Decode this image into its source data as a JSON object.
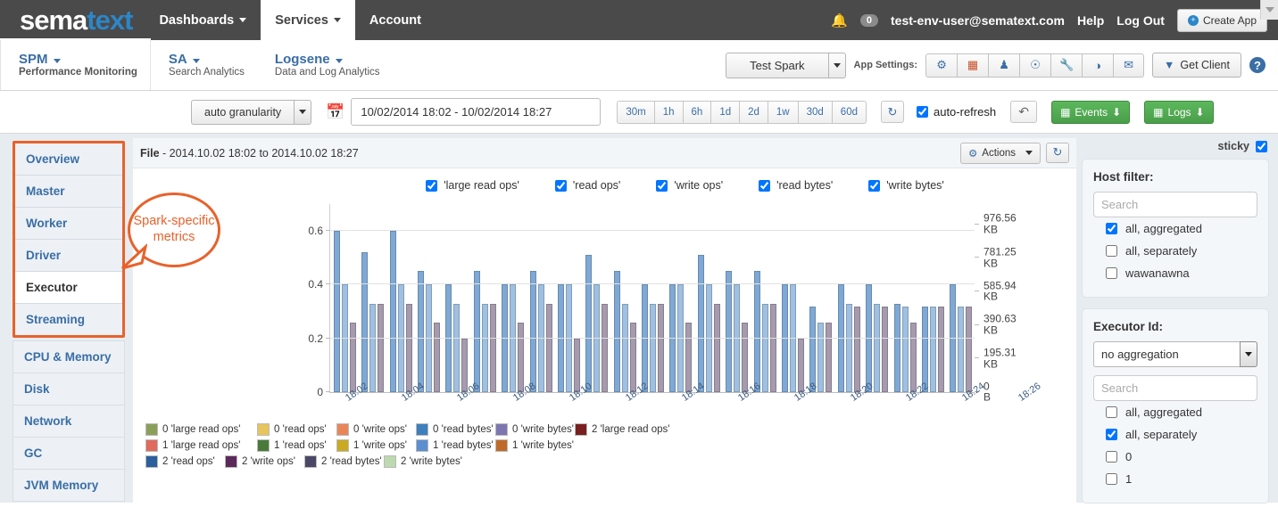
{
  "brand": {
    "part1": "sema",
    "part2": "text",
    "accent": "#2c86c8"
  },
  "topnav": {
    "items": [
      {
        "label": "Dashboards",
        "caret": true,
        "active": false
      },
      {
        "label": "Services",
        "caret": true,
        "active": true
      },
      {
        "label": "Account",
        "caret": false,
        "active": false
      }
    ],
    "bell_icon": "bell-icon",
    "notification_count": "0",
    "user_email": "test-env-user@sematext.com",
    "help": "Help",
    "logout": "Log Out",
    "create_app": "Create App"
  },
  "apptabs": [
    {
      "title": "SPM",
      "subtitle": "Performance Monitoring",
      "active": true
    },
    {
      "title": "SA",
      "subtitle": "Search Analytics",
      "active": false
    },
    {
      "title": "Logsene",
      "subtitle": "Data and Log Analytics",
      "active": false
    }
  ],
  "subbar": {
    "app_selected": "Test Spark",
    "app_settings_label": "App Settings:",
    "icons": [
      "gear-icon",
      "card-icon",
      "group-icon",
      "bell-icon",
      "wrench-icon",
      "speedometer-icon",
      "envelope-icon"
    ],
    "get_client": "Get Client",
    "help_icon": "help-icon"
  },
  "filterbar": {
    "granularity": "auto granularity",
    "calendar_icon": "calendar-icon",
    "date_range": "10/02/2014 18:02 - 10/02/2014 18:27",
    "ranges": [
      "30m",
      "1h",
      "6h",
      "1d",
      "2d",
      "1w",
      "30d",
      "60d"
    ],
    "refresh_icon": "refresh-icon",
    "auto_refresh_label": "auto-refresh",
    "auto_refresh_checked": true,
    "undo_icon": "undo-icon",
    "events_button": "Events",
    "logs_button": "Logs"
  },
  "sidebar": {
    "highlight_color": "#e8622c",
    "spark_group": [
      {
        "label": "Overview",
        "active": false
      },
      {
        "label": "Master",
        "active": false
      },
      {
        "label": "Worker",
        "active": false
      },
      {
        "label": "Driver",
        "active": false
      },
      {
        "label": "Executor",
        "active": true
      },
      {
        "label": "Streaming",
        "active": false
      }
    ],
    "other_group": [
      {
        "label": "CPU & Memory"
      },
      {
        "label": "Disk"
      },
      {
        "label": "Network"
      },
      {
        "label": "GC"
      },
      {
        "label": "JVM Memory"
      }
    ]
  },
  "callout": {
    "text": "Spark-specific metrics",
    "color": "#e8622c"
  },
  "chart_panel": {
    "title_bold": "File",
    "title_rest": " - 2014.10.02 18:02 to 2014.10.02 18:27",
    "actions_label": "Actions",
    "actions_icon": "gears-icon",
    "refresh_icon": "refresh-icon",
    "series_toggles": [
      {
        "label": "'large read ops'",
        "checked": true
      },
      {
        "label": "'read ops'",
        "checked": true
      },
      {
        "label": "'write ops'",
        "checked": true
      },
      {
        "label": "'read bytes'",
        "checked": true
      },
      {
        "label": "'write bytes'",
        "checked": true
      }
    ]
  },
  "right_panel": {
    "sticky_label": "sticky",
    "sticky_checked": true,
    "host_filter": {
      "title": "Host filter:",
      "search_placeholder": "Search",
      "search_value": "",
      "options": [
        {
          "label": "all, aggregated",
          "checked": true
        },
        {
          "label": "all, separately",
          "checked": false
        },
        {
          "label": "wawanawna",
          "checked": false
        }
      ]
    },
    "executor_id": {
      "title": "Executor Id:",
      "aggregation": "no aggregation",
      "search_placeholder": "Search",
      "search_value": "",
      "options": [
        {
          "label": "all, aggregated",
          "checked": false
        },
        {
          "label": "all, separately",
          "checked": true
        },
        {
          "label": "0",
          "checked": false
        },
        {
          "label": "1",
          "checked": false
        }
      ]
    }
  },
  "chart_data": {
    "type": "bar",
    "title": "File - 2014.10.02 18:02 to 2014.10.02 18:27",
    "xlabel": "",
    "ylabel": "",
    "grid": true,
    "legend_position": "bottom",
    "left_axis": {
      "ticks": [
        "0",
        "0.2",
        "0.4",
        "0.6"
      ],
      "values": [
        0,
        0.2,
        0.4,
        0.6
      ],
      "ylim": [
        0,
        0.7
      ]
    },
    "right_axis": {
      "ticks": [
        "0 B",
        "195.31 KB",
        "390.63 KB",
        "585.94 KB",
        "781.25 KB",
        "976.56 KB"
      ],
      "values": [
        0,
        195.31,
        390.63,
        585.94,
        781.25,
        976.56
      ],
      "unit": "KB",
      "ylim": [
        0,
        1093.75
      ]
    },
    "x_tick_labels": [
      "18:02",
      "18:04",
      "18:06",
      "18:08",
      "18:10",
      "18:12",
      "18:14",
      "18:16",
      "18:18",
      "18:20",
      "18:22",
      "18:24",
      "18:26"
    ],
    "series": [
      {
        "name": "0 'read bytes'",
        "color": "#7fa9d4",
        "values": [
          0.6,
          0.52,
          0.6,
          0.45,
          0.4,
          0.45,
          0.4,
          0.45,
          0.4,
          0.51,
          0.45,
          0.4,
          0.4,
          0.51,
          0.45,
          0.45,
          0.4,
          0.32,
          0.4,
          0.4,
          0.33,
          0.32,
          0.4
        ]
      },
      {
        "name": "1 'read bytes'",
        "color": "#9fc0e0",
        "values": [
          0.4,
          0.33,
          0.4,
          0.4,
          0.33,
          0.33,
          0.4,
          0.4,
          0.4,
          0.4,
          0.33,
          0.33,
          0.4,
          0.4,
          0.4,
          0.33,
          0.4,
          0.26,
          0.33,
          0.33,
          0.32,
          0.32,
          0.32
        ]
      },
      {
        "name": "2 'read bytes'",
        "color": "#a59aae",
        "values": [
          0.26,
          0.33,
          0.33,
          0.26,
          0.2,
          0.33,
          0.26,
          0.33,
          0.2,
          0.33,
          0.26,
          0.33,
          0.26,
          0.33,
          0.26,
          0.33,
          0.2,
          0.26,
          0.32,
          0.32,
          0.26,
          0.32,
          0.32
        ]
      }
    ],
    "baseline_color": "#5a3a63"
  },
  "chart_legend": [
    {
      "label": "0 'large read ops'",
      "color": "#8aa05a"
    },
    {
      "label": "0 'read ops'",
      "color": "#e8c45c"
    },
    {
      "label": "0 'write ops'",
      "color": "#e8865a"
    },
    {
      "label": "0 'read bytes'",
      "color": "#3e7fbe"
    },
    {
      "label": "0 'write bytes'",
      "color": "#7e76b0"
    },
    {
      "label": "1 'large read ops'",
      "color": "#e06a5c"
    },
    {
      "label": "1 'read ops'",
      "color": "#4a7a3a"
    },
    {
      "label": "1 'write ops'",
      "color": "#c9aa22"
    },
    {
      "label": "1 'read bytes'",
      "color": "#5b8fd0"
    },
    {
      "label": "1 'write bytes'",
      "color": "#c06a2a"
    },
    {
      "label": "2 'large read ops'",
      "color": "#7a1f1f"
    },
    {
      "label": "2 'read ops'",
      "color": "#2b5f9e"
    },
    {
      "label": "2 'write ops'",
      "color": "#5b2a5b"
    },
    {
      "label": "2 'read bytes'",
      "color": "#4a4766"
    },
    {
      "label": "2 'write bytes'",
      "color": "#bcd9b0"
    }
  ]
}
